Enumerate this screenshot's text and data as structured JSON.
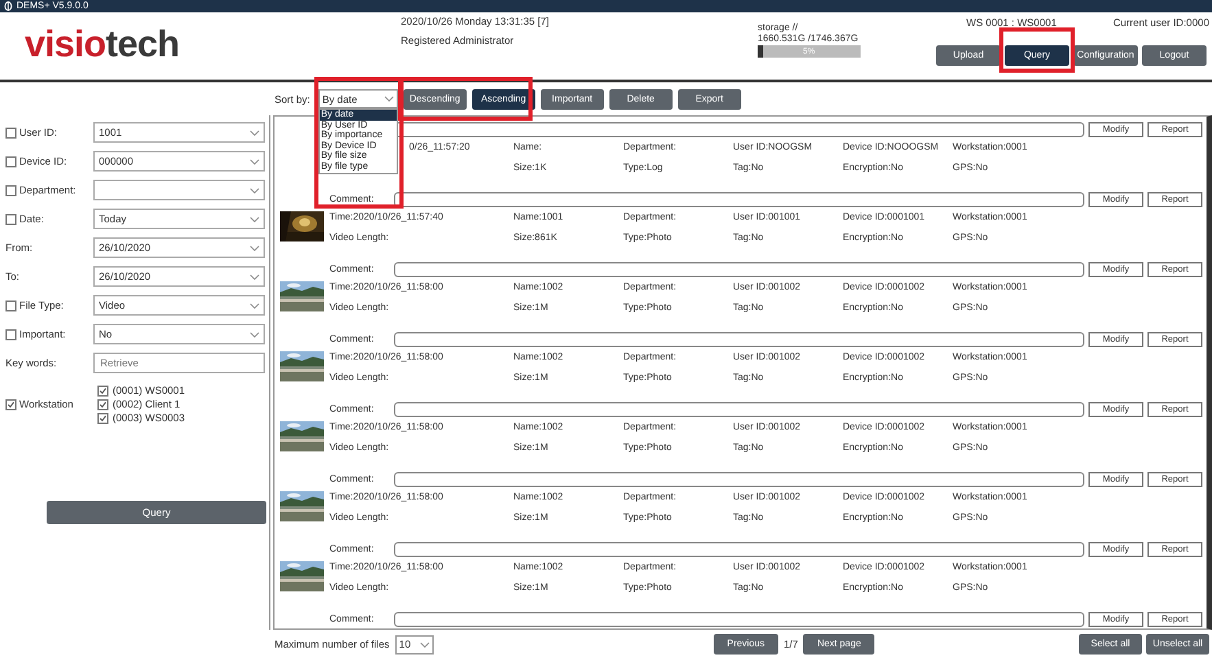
{
  "window": {
    "title": "DEMS+ V5.9.0.0"
  },
  "header": {
    "logo": [
      "visio",
      "tech"
    ],
    "datetime": "2020/10/26 Monday 13:31:35 [7]",
    "role": "Registered Administrator",
    "storage_label": "storage //",
    "storage_value": "1660.531G /1746.367G",
    "storage": {
      "level": 0.05,
      "reading": "5%"
    },
    "workstation": "WS 0001 : WS0001",
    "current_user": "Current user ID:0000"
  },
  "nav": [
    {
      "label": "Upload",
      "selected": false,
      "highlighted": false
    },
    {
      "label": "Query",
      "selected": true,
      "highlighted": true
    },
    {
      "label": "Configuration",
      "selected": false,
      "highlighted": false
    },
    {
      "label": "Logout",
      "selected": false,
      "highlighted": false
    }
  ],
  "toolbar": {
    "sort_label": "Sort by:",
    "sort_value": "By date",
    "sort_highlighted": true,
    "sort_options": [
      {
        "label": "By date",
        "selected": true
      },
      {
        "label": "By User ID",
        "selected": false
      },
      {
        "label": "By importance",
        "selected": false
      },
      {
        "label": "By Device ID",
        "selected": false
      },
      {
        "label": "By file size",
        "selected": false
      },
      {
        "label": "By file type",
        "selected": false
      }
    ],
    "order_highlighted": true,
    "order": [
      {
        "label": "Descending",
        "selected": false
      },
      {
        "label": "Ascending",
        "selected": true
      }
    ],
    "actions": [
      "Important",
      "Delete",
      "Export"
    ]
  },
  "filters": [
    {
      "kind": "select",
      "label": "User ID:",
      "checked": false,
      "value": "1001"
    },
    {
      "kind": "select",
      "label": "Device ID:",
      "checked": false,
      "value": "000000"
    },
    {
      "kind": "select",
      "label": "Department:",
      "checked": false
    },
    {
      "kind": "select",
      "label": "Date:",
      "checked": false,
      "value": "Today"
    },
    {
      "kind": "select",
      "label": "From:",
      "value": "26/10/2020"
    },
    {
      "kind": "select",
      "label": "To:",
      "value": "26/10/2020"
    },
    {
      "kind": "select",
      "label": "File Type:",
      "checked": false,
      "value": "Video"
    },
    {
      "kind": "select",
      "label": "Important:",
      "checked": false,
      "value": "No"
    },
    {
      "kind": "input",
      "label": "Key words:",
      "placeholder": "Retrieve"
    },
    {
      "kind": "list",
      "label": "Workstation",
      "checked": true,
      "items": [
        {
          "label": "(0001) WS0001",
          "checked": true
        },
        {
          "label": "(0002) Client 1",
          "checked": true
        },
        {
          "label": "(0003) WS0003",
          "checked": true
        }
      ]
    }
  ],
  "query_button": "Query",
  "records": [
    {
      "covered": true,
      "line1": [
        "0/26_11:57:20",
        "Name:",
        "Department:",
        "User ID:NOOGSM",
        "Device ID:NOOOGSM",
        "Workstation:0001"
      ],
      "line2": [
        "Size:1K",
        "Type:Log",
        "Tag:No",
        "Encryption:No",
        "GPS:No"
      ],
      "buttons": [
        "Modify",
        "Report"
      ]
    },
    {
      "comment_label": "Comment:",
      "thumbnail": {
        "kind": "picture"
      },
      "line1": [
        "Time:2020/10/26_11:57:40",
        "Name:1001",
        "Department:",
        "User ID:001001",
        "Device ID:0001001",
        "Workstation:0001"
      ],
      "line2": [
        "Video Length:",
        "Size:861K",
        "Type:Photo",
        "Tag:No",
        "Encryption:No",
        "GPS:No"
      ],
      "buttons": [
        "Modify",
        "Report"
      ]
    },
    {
      "comment_label": "Comment:",
      "thumbnail": {
        "kind": "picture"
      },
      "line1": [
        "Time:2020/10/26_11:58:00",
        "Name:1002",
        "Department:",
        "User ID:001002",
        "Device ID:0001002",
        "Workstation:0001"
      ],
      "line2": [
        "Video Length:",
        "Size:1M",
        "Type:Photo",
        "Tag:No",
        "Encryption:No",
        "GPS:No"
      ],
      "buttons": [
        "Modify",
        "Report"
      ]
    },
    {
      "comment_label": "Comment:",
      "thumbnail": {
        "kind": "picture"
      },
      "line1": [
        "Time:2020/10/26_11:58:00",
        "Name:1002",
        "Department:",
        "User ID:001002",
        "Device ID:0001002",
        "Workstation:0001"
      ],
      "line2": [
        "Video Length:",
        "Size:1M",
        "Type:Photo",
        "Tag:No",
        "Encryption:No",
        "GPS:No"
      ],
      "buttons": [
        "Modify",
        "Report"
      ]
    },
    {
      "comment_label": "Comment:",
      "thumbnail": {
        "kind": "picture"
      },
      "line1": [
        "Time:2020/10/26_11:58:00",
        "Name:1002",
        "Department:",
        "User ID:001002",
        "Device ID:0001002",
        "Workstation:0001"
      ],
      "line2": [
        "Video Length:",
        "Size:1M",
        "Type:Photo",
        "Tag:No",
        "Encryption:No",
        "GPS:No"
      ],
      "buttons": [
        "Modify",
        "Report"
      ]
    },
    {
      "comment_label": "Comment:",
      "thumbnail": {
        "kind": "picture"
      },
      "line1": [
        "Time:2020/10/26_11:58:00",
        "Name:1002",
        "Department:",
        "User ID:001002",
        "Device ID:0001002",
        "Workstation:0001"
      ],
      "line2": [
        "Video Length:",
        "Size:1M",
        "Type:Photo",
        "Tag:No",
        "Encryption:No",
        "GPS:No"
      ],
      "buttons": [
        "Modify",
        "Report"
      ]
    },
    {
      "comment_label": "Comment:",
      "thumbnail": {
        "kind": "picture"
      },
      "line1": [
        "Time:2020/10/26_11:58:00",
        "Name:1002",
        "Department:",
        "User ID:001002",
        "Device ID:0001002",
        "Workstation:0001"
      ],
      "line2": [
        "Video Length:",
        "Size:1M",
        "Type:Photo",
        "Tag:No",
        "Encryption:No",
        "GPS:No"
      ],
      "buttons": [
        "Modify",
        "Report"
      ]
    },
    {
      "comment_label": "Comment:",
      "buttons": [
        "Modify",
        "Report"
      ]
    }
  ],
  "footer": {
    "max_label": "Maximum number of files",
    "max_value": "10",
    "previous": "Previous",
    "page": "1/7",
    "next": "Next page",
    "select_all": "Select all",
    "unselect_all": "Unselect all"
  }
}
